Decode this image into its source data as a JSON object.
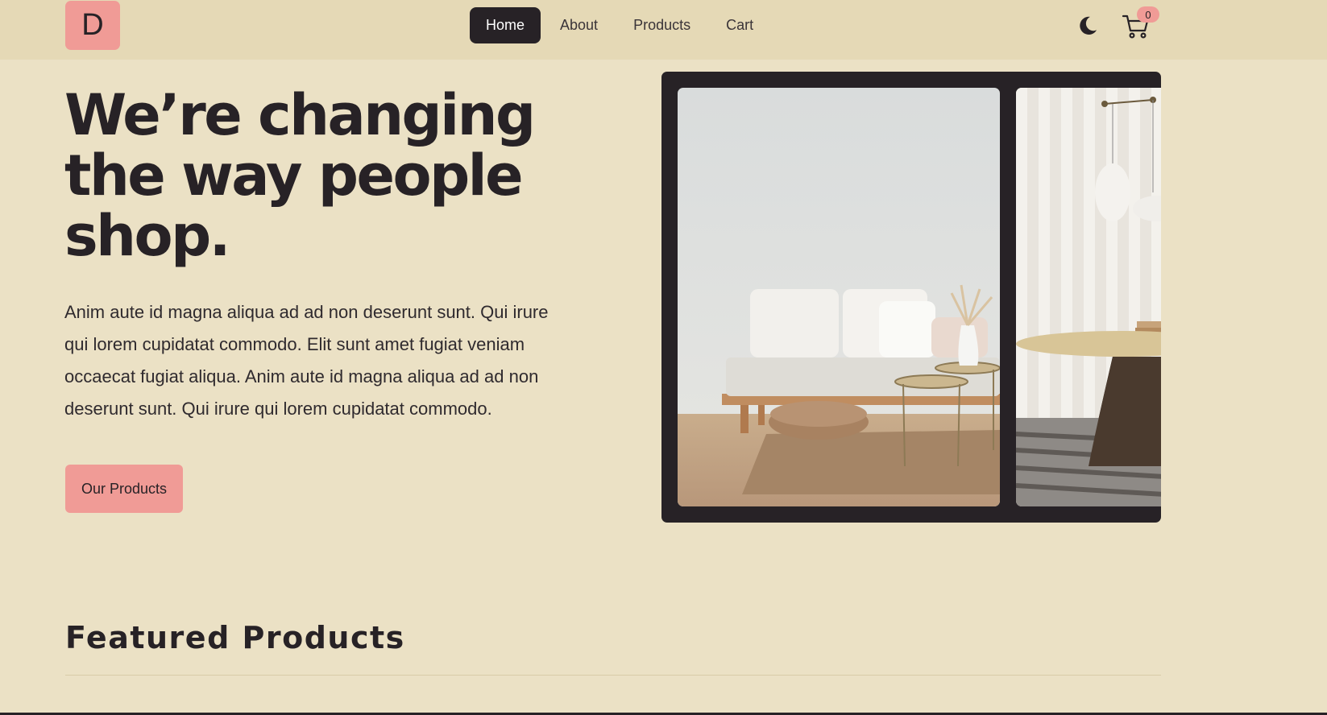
{
  "navbar": {
    "logo_text": "D",
    "links": [
      {
        "label": "Home",
        "active": true
      },
      {
        "label": "About"
      },
      {
        "label": "Products"
      },
      {
        "label": "Cart"
      }
    ],
    "theme_toggle_icon": "moon-icon",
    "cart_icon": "cart-icon",
    "cart_count": "0"
  },
  "hero": {
    "title": "We’re changing the way people shop.",
    "description": "Anim aute id magna aliqua ad ad non deserunt sunt. Qui irure qui lorem cupidatat commodo. Elit sunt amet fugiat veniam occaecat fugiat aliqua. Anim aute id magna aliqua ad ad non deserunt sunt. Qui irure qui lorem cupidatat commodo.",
    "cta_label": "Our Products"
  },
  "carousel": {
    "images": [
      "living-room-sofa-photo",
      "dining-table-pendant-lamps-photo"
    ]
  },
  "featured": {
    "title": "Featured Products"
  },
  "colors": {
    "background": "#ebe1c5",
    "navbar": "#e5d9b6",
    "accent": "#f09b96",
    "dark": "#272226"
  }
}
